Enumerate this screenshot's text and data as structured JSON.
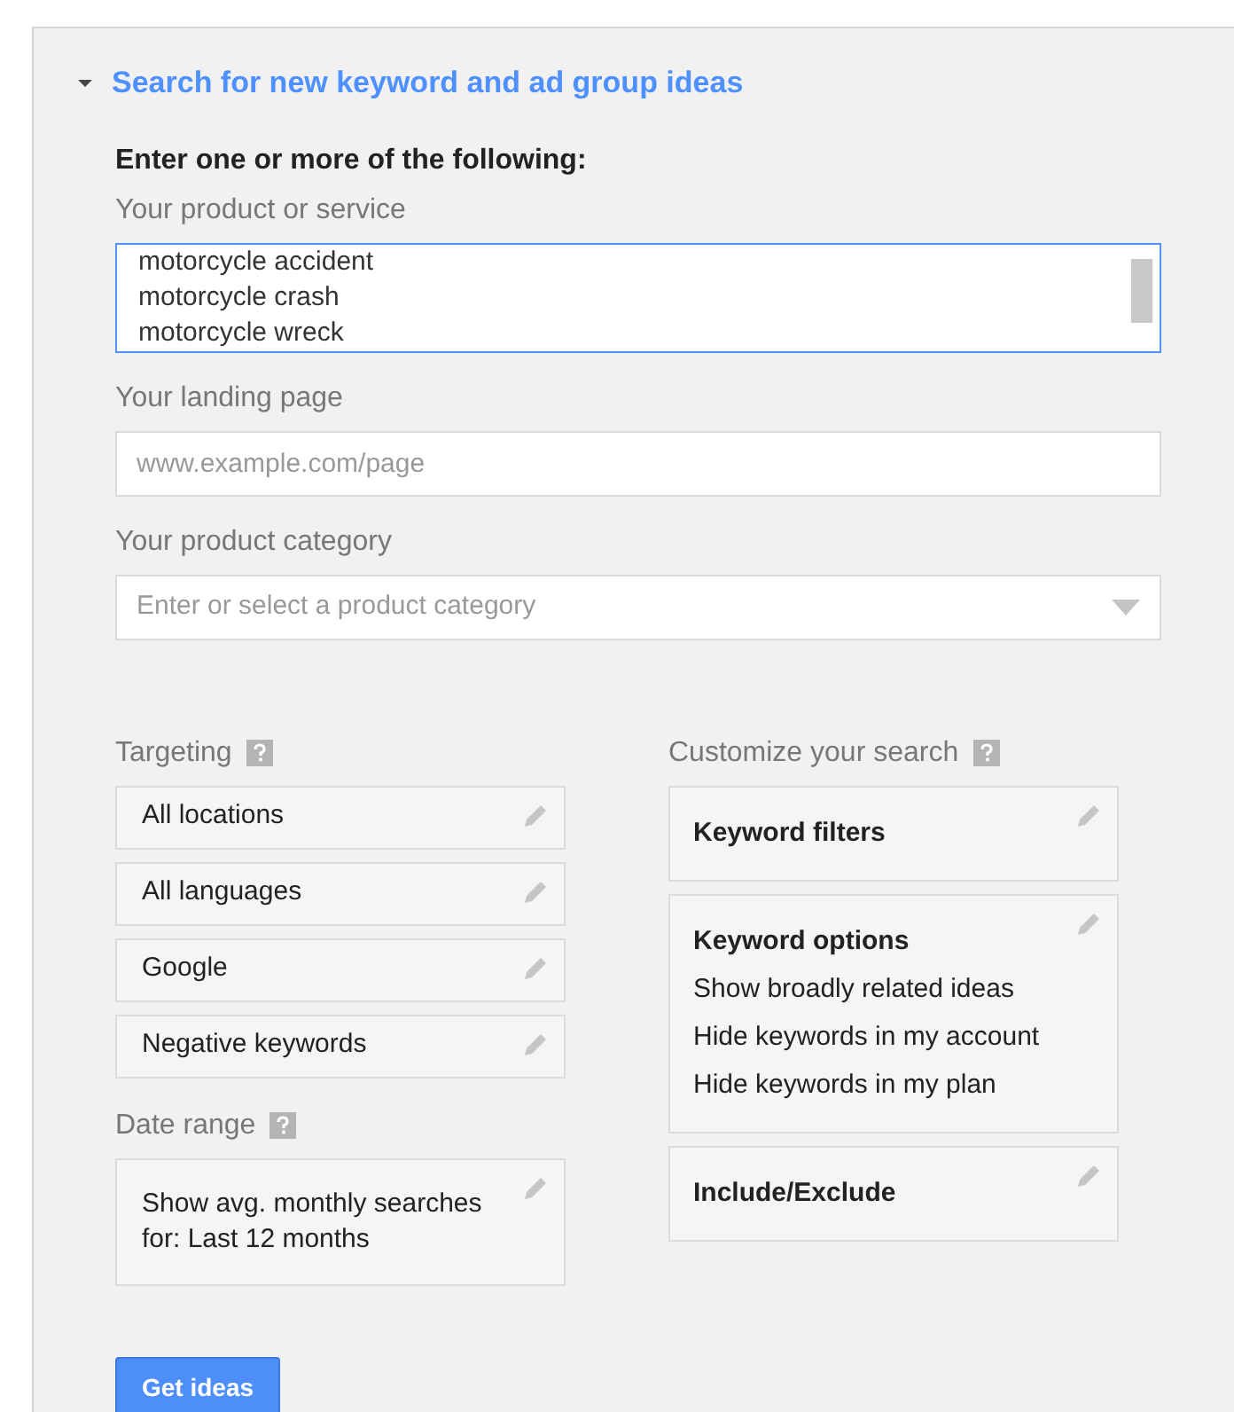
{
  "section": {
    "title": "Search for new keyword and ad group ideas",
    "expanded": true
  },
  "intro": "Enter one or more of the following:",
  "product_field": {
    "label": "Your product or service",
    "lines": [
      "motorcycle accident",
      "motorcycle crash",
      "motorcycle wreck"
    ]
  },
  "landing_field": {
    "label": "Your landing page",
    "placeholder": "www.example.com/page"
  },
  "category_field": {
    "label": "Your product category",
    "placeholder": "Enter or select a product category"
  },
  "targeting": {
    "title": "Targeting",
    "items": [
      "All locations",
      "All languages",
      "Google",
      "Negative keywords"
    ]
  },
  "date_range": {
    "title": "Date range",
    "text": "Show avg. monthly searches for: Last 12 months"
  },
  "customize": {
    "title": "Customize your search",
    "cards": [
      {
        "title": "Keyword filters"
      },
      {
        "title": "Keyword options",
        "lines": [
          "Show broadly related ideas",
          "Hide keywords in my account",
          "Hide keywords in my plan"
        ]
      },
      {
        "title": "Include/Exclude"
      }
    ]
  },
  "button": "Get ideas"
}
